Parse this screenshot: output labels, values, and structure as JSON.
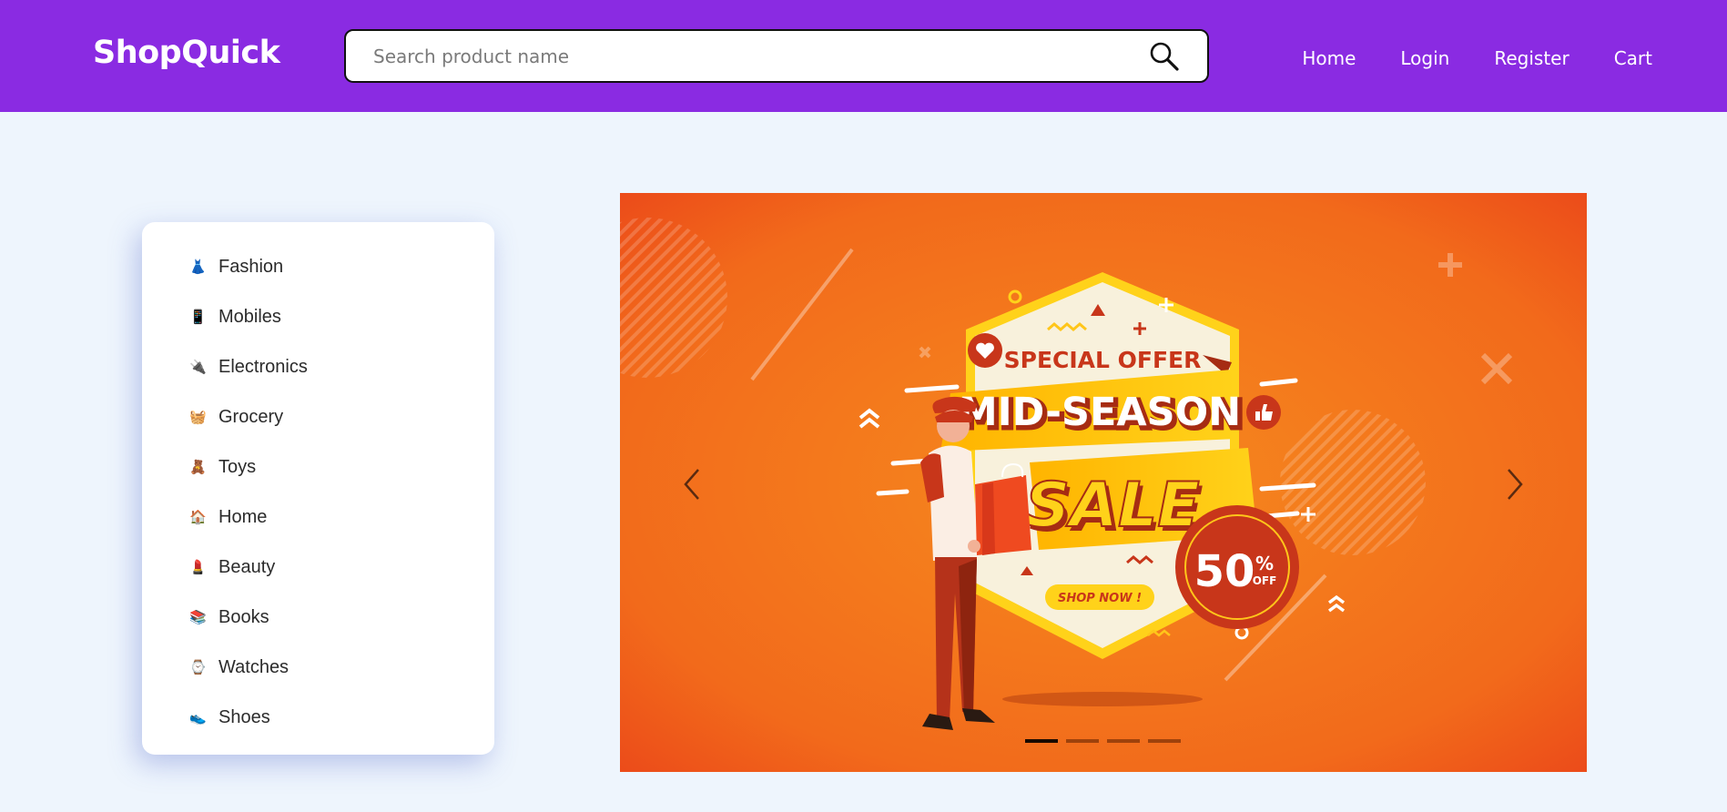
{
  "header": {
    "brand": "ShopQuick",
    "search": {
      "placeholder": "Search product name",
      "value": "",
      "icon": "search-icon"
    },
    "nav": [
      {
        "label": "Home"
      },
      {
        "label": "Login"
      },
      {
        "label": "Register"
      },
      {
        "label": "Cart"
      }
    ]
  },
  "categories": [
    {
      "label": "Fashion",
      "icon": "dress-icon",
      "glyph": "👗"
    },
    {
      "label": "Mobiles",
      "icon": "mobile-phone-icon",
      "glyph": "📱"
    },
    {
      "label": "Electronics",
      "icon": "electronics-icon",
      "glyph": "🔌"
    },
    {
      "label": "Grocery",
      "icon": "grocery-basket-icon",
      "glyph": "🧺"
    },
    {
      "label": "Toys",
      "icon": "teddy-bear-icon",
      "glyph": "🧸"
    },
    {
      "label": "Home",
      "icon": "home-furniture-icon",
      "glyph": "🏠"
    },
    {
      "label": "Beauty",
      "icon": "beauty-icon",
      "glyph": "💄"
    },
    {
      "label": "Books",
      "icon": "books-icon",
      "glyph": "📚"
    },
    {
      "label": "Watches",
      "icon": "watch-icon",
      "glyph": "⌚"
    },
    {
      "label": "Shoes",
      "icon": "shoe-icon",
      "glyph": "👟"
    }
  ],
  "carousel": {
    "banner": {
      "top_text": "SPECIAL OFFER",
      "headline": "MID-SEASON",
      "sale": "SALE",
      "discount_number": "50",
      "discount_percent": "%",
      "discount_off": "OFF",
      "cta": "SHOP NOW !"
    },
    "slide_count": 4,
    "active_slide": 1
  },
  "colors": {
    "navbar": "#8a2be2",
    "page_bg": "#eef5fd",
    "banner_orange": "#f47a1f",
    "banner_red": "#c8361a",
    "banner_yellow": "#ffc61a"
  }
}
